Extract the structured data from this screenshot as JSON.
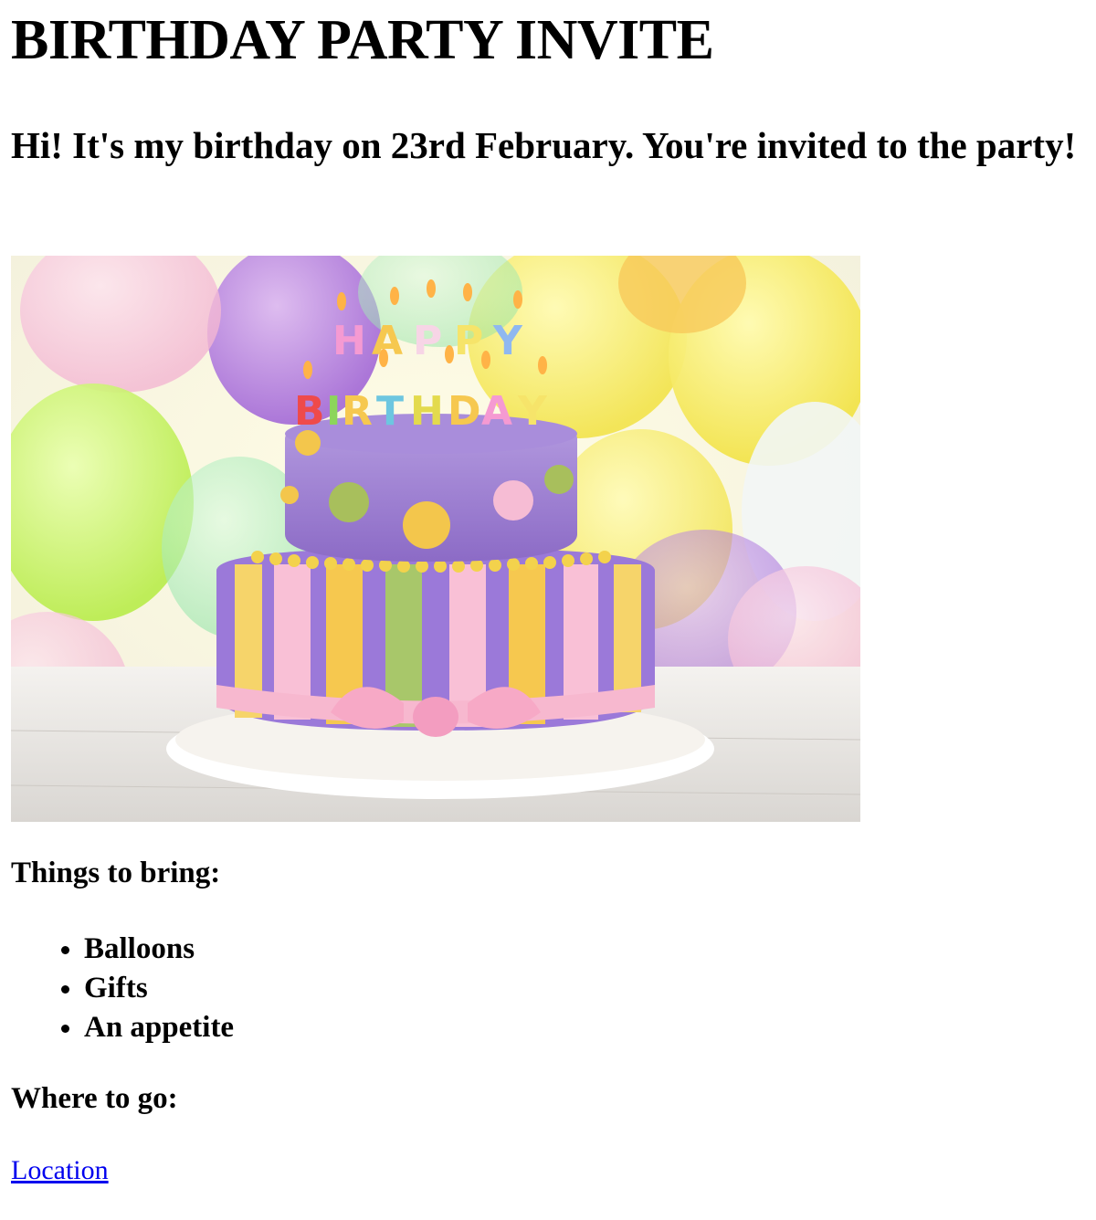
{
  "page": {
    "title": "BIRTHDAY PARTY INVITE",
    "message": "Hi! It's my birthday on 23rd February. You're invited to the party!",
    "image": {
      "semantic": "birthday-cake-photo",
      "cake_text_top": "HAPPY",
      "cake_text_bottom": "BIRTHDAY"
    },
    "bring_heading": "Things to bring:",
    "bring_items": [
      "Balloons",
      "Gifts",
      "An appetite"
    ],
    "where_heading": "Where to go:",
    "location_link": "Location"
  },
  "colors": {
    "link": "#0000ee",
    "text": "#000000",
    "background": "#ffffff"
  }
}
